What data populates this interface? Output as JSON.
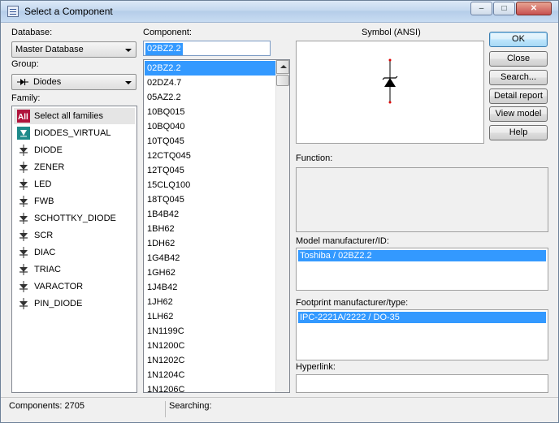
{
  "window": {
    "title": "Select a Component",
    "minimize_icon": "minimize-icon",
    "maximize_icon": "maximize-icon",
    "close_icon": "close-icon"
  },
  "database": {
    "label": "Database:",
    "value": "Master Database"
  },
  "group": {
    "label": "Group:",
    "value": "Diodes",
    "icon": "diode-icon"
  },
  "family": {
    "label": "Family:",
    "items": [
      {
        "label": "Select all families",
        "icon": "all-families-icon"
      },
      {
        "label": "DIODES_VIRTUAL",
        "icon": "virtual-diode-icon"
      },
      {
        "label": "DIODE",
        "icon": "diode-icon"
      },
      {
        "label": "ZENER",
        "icon": "zener-icon"
      },
      {
        "label": "LED",
        "icon": "led-icon"
      },
      {
        "label": "FWB",
        "icon": "bridge-rectifier-icon"
      },
      {
        "label": "SCHOTTKY_DIODE",
        "icon": "schottky-icon"
      },
      {
        "label": "SCR",
        "icon": "scr-icon"
      },
      {
        "label": "DIAC",
        "icon": "diac-icon"
      },
      {
        "label": "TRIAC",
        "icon": "triac-icon"
      },
      {
        "label": "VARACTOR",
        "icon": "varactor-icon"
      },
      {
        "label": "PIN_DIODE",
        "icon": "pin-diode-icon"
      }
    ]
  },
  "component": {
    "label": "Component:",
    "value": "02BZ2.2",
    "items": [
      "02BZ2.2",
      "02DZ4.7",
      "05AZ2.2",
      "10BQ015",
      "10BQ040",
      "10TQ045",
      "12CTQ045",
      "12TQ045",
      "15CLQ100",
      "18TQ045",
      "1B4B42",
      "1BH62",
      "1DH62",
      "1G4B42",
      "1GH62",
      "1J4B42",
      "1JH62",
      "1LH62",
      "1N1199C",
      "1N1200C",
      "1N1202C",
      "1N1204C",
      "1N1206C"
    ]
  },
  "symbol": {
    "label": "Symbol (ANSI)"
  },
  "function": {
    "label": "Function:"
  },
  "model": {
    "label": "Model manufacturer/ID:",
    "value": "Toshiba / 02BZ2.2"
  },
  "footprint": {
    "label": "Footprint manufacturer/type:",
    "value": "IPC-2221A/2222 / DO-35"
  },
  "hyperlink": {
    "label": "Hyperlink:"
  },
  "buttons": {
    "ok": "OK",
    "close": "Close",
    "search": "Search...",
    "detail_report": "Detail report",
    "view_model": "View model",
    "help": "Help"
  },
  "status": {
    "components": "Components: 2705",
    "searching": "Searching:"
  },
  "colors": {
    "selection": "#3399ff",
    "dialog_bg": "#f0f0f0"
  }
}
